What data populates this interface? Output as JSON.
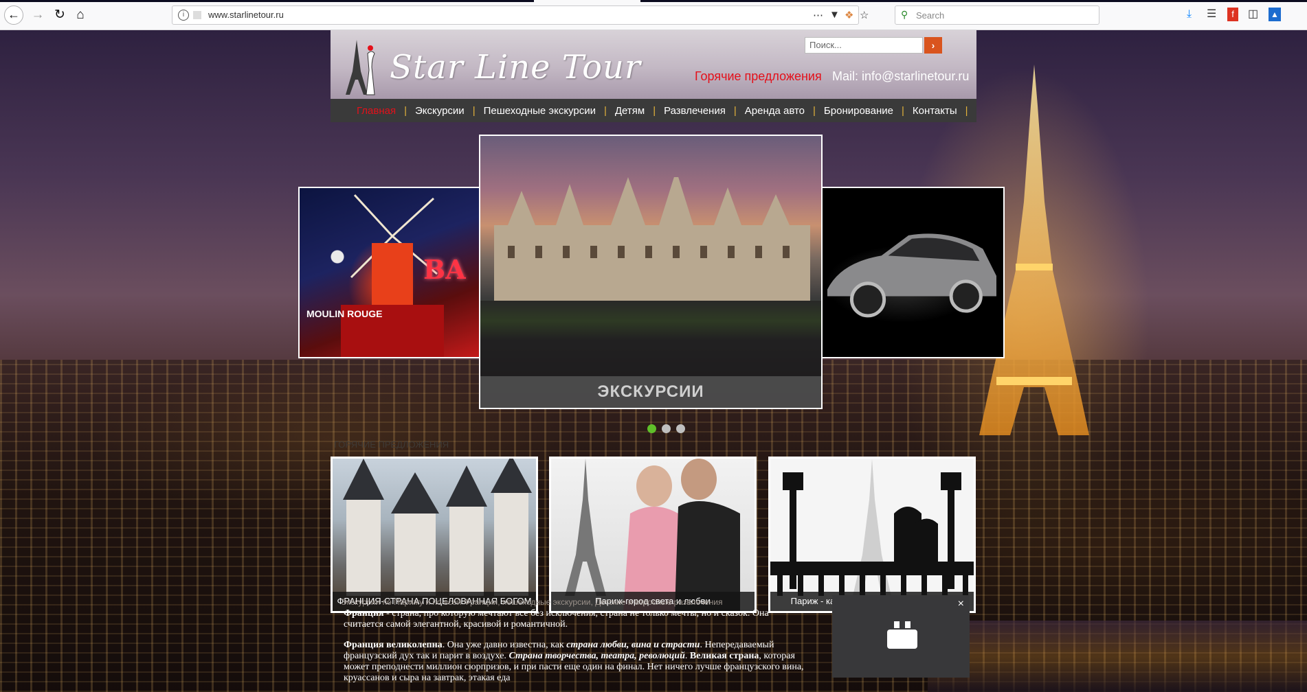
{
  "browser": {
    "url": "www.starlinetour.ru",
    "search_placeholder": "Search",
    "icons": [
      "back-icon",
      "forward-icon",
      "reload-icon",
      "home-icon",
      "info-icon",
      "more-icon",
      "pocket-icon",
      "extension-icon",
      "bookmark-star-icon",
      "download-icon",
      "library-icon",
      "flash-icon",
      "sidebar-icon",
      "screenshot-icon"
    ]
  },
  "header": {
    "logo": "Star Line Tour",
    "search_placeholder": "Поиск...",
    "hot_offers": "Горячие предложения",
    "mail": "Mail: info@starlinetour.ru"
  },
  "nav": {
    "items": [
      {
        "label": "Главная",
        "active": true
      },
      {
        "label": "Экскурсии",
        "active": false
      },
      {
        "label": "Пешеходные экскурсии",
        "active": false
      },
      {
        "label": "Детям",
        "active": false
      },
      {
        "label": "Развлечения",
        "active": false
      },
      {
        "label": "Аренда авто",
        "active": false
      },
      {
        "label": "Бронирование",
        "active": false
      },
      {
        "label": "Контакты",
        "active": false
      }
    ],
    "active_color": "#e4101a",
    "separator_color": "#e3b33a"
  },
  "carousel": {
    "caption": "ЭКСКУРСИИ",
    "left_sign": "BA",
    "left_sign2": "MOULIN ROUGE",
    "dots": 3,
    "active_dot": 0
  },
  "offers": {
    "title": "горячие предложения",
    "cards": [
      {
        "caption": "ФРАНЦИЯ-СТРАНА ПОЦЕЛОВАННАЯ БОГОМ"
      },
      {
        "caption": "Париж-город света и любви"
      },
      {
        "caption": "Париж - как много звуков в этом слове!"
      }
    ]
  },
  "about": {
    "meta": "Экскурсии по Парижу и по всей Франции, пешеходные экскурсии, Детские и взрослые развлечения",
    "p1_bold": "Франция",
    "p1_rest": " - страна, про которую мечтают все без исключения, страна не только мечты, но и сказок. Она считается самой элегантной, красивой и романтичной.",
    "p2_bold1": "Франция великолепна",
    "p2_a": ". Она уже давно известна, как ",
    "p2_em1": "страна любви, вина и страсти",
    "p2_b": ". Непередаваемый французский дух так и парит в воздухе. ",
    "p2_em2": "Страна творчества, театра, революций",
    "p2_c": ". ",
    "p2_bold2": "Великая страна",
    "p2_d": ", которая может преподнести миллион сюрпризов, и при пасти еще один на финал. Нет ничего лучше французского вина, круассанов и сыра на завтрак, этакая еда"
  },
  "popup": {
    "close": "×"
  }
}
